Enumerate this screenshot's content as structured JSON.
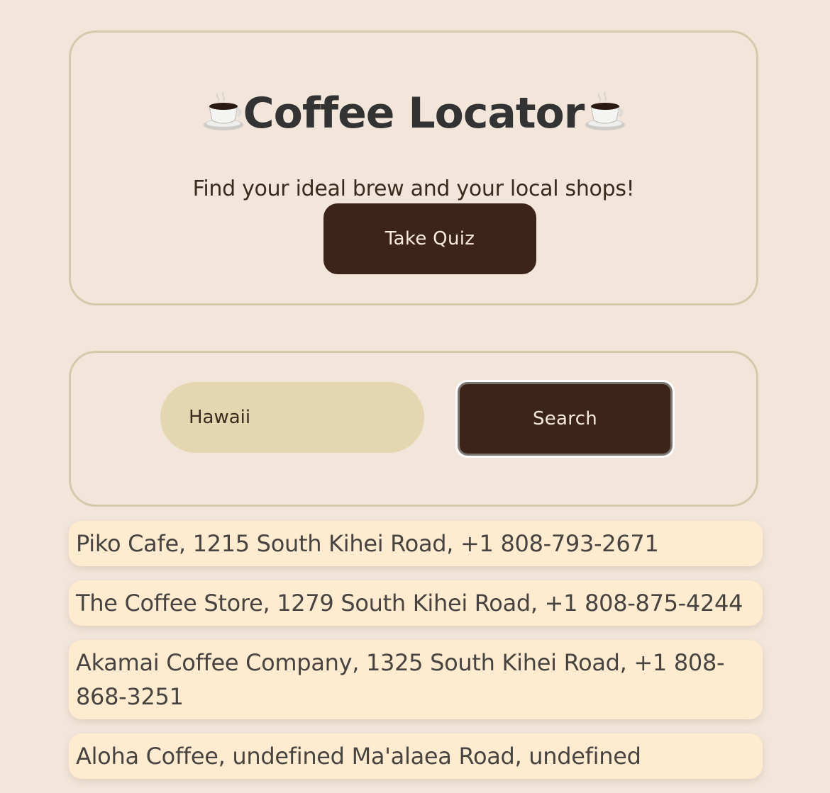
{
  "header": {
    "title": "Coffee Locator",
    "title_icon_left": "hot-beverage-icon",
    "title_icon_right": "hot-beverage-icon",
    "tagline": "Find your ideal brew and your local shops!",
    "quiz_button_label": "Take Quiz"
  },
  "search": {
    "value": "Hawaii",
    "button_label": "Search"
  },
  "results": [
    "Piko Cafe, 1215 South Kihei Road, +1 808-793-2671",
    "The Coffee Store, 1279 South Kihei Road, +1 808-875-4244",
    "Akamai Coffee Company, 1325 South Kihei Road, +1 808-868-3251",
    "Aloha Coffee, undefined Ma'alaea Road, undefined"
  ],
  "colors": {
    "background": "#f2e6da",
    "panel_border": "#d6c8aa",
    "button_bg": "#3d2418",
    "input_bg": "#e4d6b1",
    "result_bg": "#ffecd0"
  }
}
